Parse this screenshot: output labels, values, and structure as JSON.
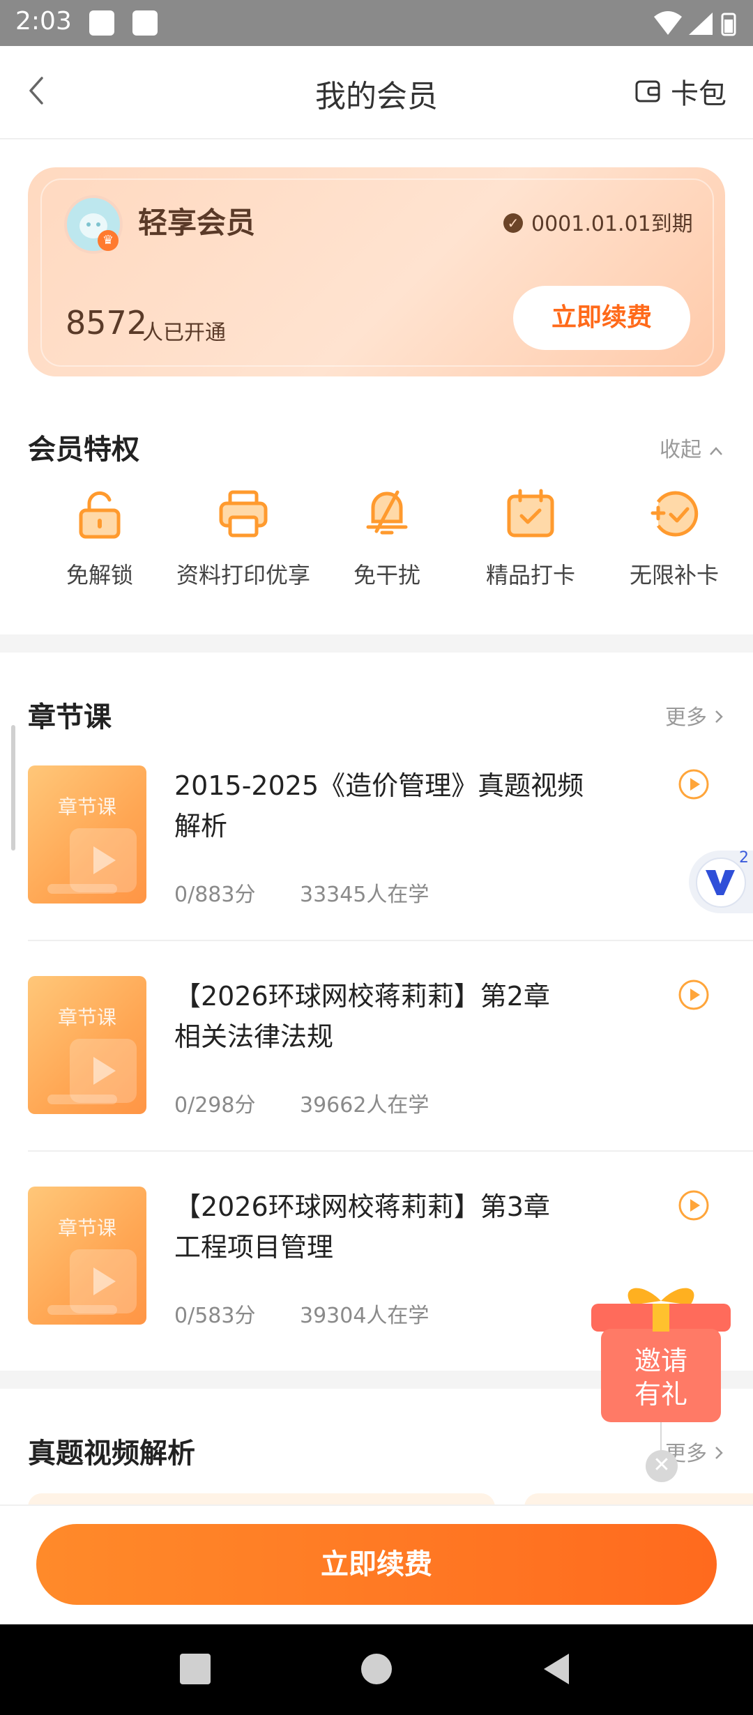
{
  "status_bar": {
    "time": "2:03"
  },
  "header": {
    "title": "我的会员",
    "wallet_label": "卡包"
  },
  "member_card": {
    "name": "轻享会员",
    "expiry": "0001.01.01到期",
    "count": "8572",
    "count_suffix": "人已开通",
    "renew_label": "立即续费"
  },
  "privileges": {
    "title": "会员特权",
    "collapse_label": "收起",
    "items": [
      {
        "label": "免解锁",
        "icon": "unlock-icon"
      },
      {
        "label": "资料打印优享",
        "icon": "printer-icon"
      },
      {
        "label": "免干扰",
        "icon": "bell-off-icon"
      },
      {
        "label": "精品打卡",
        "icon": "calendar-check-icon"
      },
      {
        "label": "无限补卡",
        "icon": "plus-check-icon"
      }
    ]
  },
  "chapter_courses": {
    "title": "章节课",
    "more_label": "更多",
    "thumb_label": "章节课",
    "items": [
      {
        "title_line1": "2015-2025《造价管理》真题视频",
        "title_line2": "解析",
        "score": "0/883分",
        "learners": "33345人在学"
      },
      {
        "title_line1": "【2026环球网校蒋莉莉】第2章",
        "title_line2": "相关法律法规",
        "score": "0/298分",
        "learners": "39662人在学"
      },
      {
        "title_line1": "【2026环球网校蒋莉莉】第3章",
        "title_line2": "工程项目管理",
        "score": "0/583分",
        "learners": "39304人在学"
      }
    ]
  },
  "video_analysis": {
    "title": "真题视频解析",
    "more_label": "更多"
  },
  "floating": {
    "v_badge_count": "2",
    "gift_line1": "邀请",
    "gift_line2": "有礼"
  },
  "bottom": {
    "renew_label": "立即续费"
  },
  "colors": {
    "accent": "#ff6a1a",
    "card_bg": "#ffd9c0",
    "icon_orange": "#ff9a2e"
  }
}
